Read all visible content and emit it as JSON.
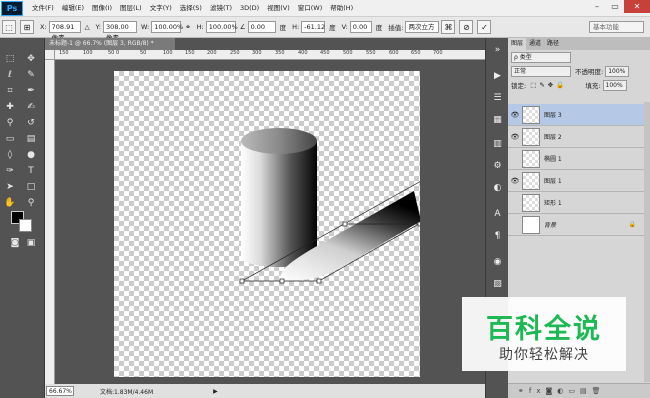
{
  "app": {
    "logo": "Ps"
  },
  "menu": [
    "文件(F)",
    "编辑(E)",
    "图像(I)",
    "图层(L)",
    "文字(Y)",
    "选择(S)",
    "滤镜(T)",
    "3D(D)",
    "视图(V)",
    "窗口(W)",
    "帮助(H)"
  ],
  "window_controls": {
    "minimize": "–",
    "restore": "▭",
    "close": "✕"
  },
  "options": {
    "x_label": "X:",
    "x_value": "708.91 像素",
    "y_label": "Y:",
    "y_value": "308.00 像素",
    "w_label": "W:",
    "w_value": "100.00%",
    "h_label": "H:",
    "h_value": "100.00%",
    "angle_value": "0.00",
    "angle_unit": "度",
    "hskew_label": "H:",
    "hskew_value": "-61.12",
    "hskew_unit": "度",
    "vskew_label": "V:",
    "vskew_value": "0.00",
    "vskew_unit": "度",
    "interp_label": "插值:",
    "interp_value": "两次立方",
    "preset": "基本功能"
  },
  "document": {
    "tab_title": "未标题-1 @ 66.7% (图层 3, RGB/8) *",
    "ruler_ticks": [
      "150",
      "100",
      "50",
      "0",
      "50",
      "100",
      "150",
      "200",
      "250",
      "300",
      "350",
      "400",
      "450",
      "500",
      "550",
      "600",
      "650",
      "700"
    ],
    "zoom": "66.67%",
    "doc_info": "文档:1.83M/4.46M"
  },
  "layers_panel": {
    "tabs": [
      "图层",
      "通道",
      "路径"
    ],
    "filter_label": "ρ 类型",
    "blend_mode": "正常",
    "opacity_label": "不透明度:",
    "opacity_value": "100%",
    "lock_label": "锁定:",
    "fill_label": "填充:",
    "fill_value": "100%",
    "layers": [
      {
        "name": "图层 3",
        "visible": true,
        "selected": true
      },
      {
        "name": "图层 2",
        "visible": true,
        "selected": false
      },
      {
        "name": "椭圆 1",
        "visible": false,
        "selected": false
      },
      {
        "name": "图层 1",
        "visible": true,
        "selected": false
      },
      {
        "name": "矩形 1",
        "visible": false,
        "selected": false
      },
      {
        "name": "背景",
        "visible": false,
        "selected": false
      }
    ]
  },
  "watermark": {
    "title": "百科全说",
    "subtitle": "助你轻松解决"
  }
}
